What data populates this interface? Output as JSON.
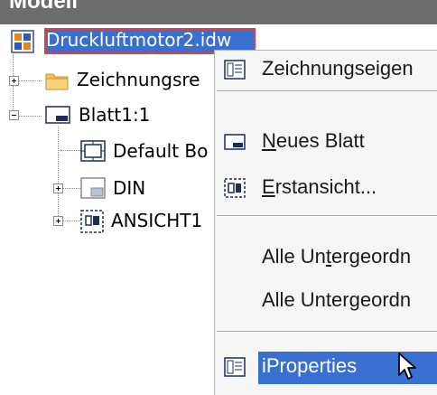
{
  "panel": {
    "title": "Modell"
  },
  "tree": {
    "root_file": "Druckluftmotor2.idw",
    "items": [
      {
        "label": "Zeichnungsre",
        "icon": "folder-icon"
      },
      {
        "label": "Blatt1:1",
        "icon": "sheet-icon"
      },
      {
        "label": "Default Bo",
        "icon": "border-icon"
      },
      {
        "label": "DIN",
        "icon": "title-block-icon"
      },
      {
        "label": "ANSICHT1",
        "icon": "base-view-icon"
      }
    ]
  },
  "context_menu": {
    "items": [
      {
        "id": "drawing-properties",
        "label": "Zeichnungseigen",
        "icon": "properties-icon"
      },
      {
        "id": "new-sheet",
        "label": "Neues Blatt",
        "icon": "sheet-icon",
        "mnemonic": "N"
      },
      {
        "id": "base-view",
        "label": "Erstansicht...",
        "icon": "base-view-icon",
        "mnemonic": "E"
      },
      {
        "id": "all-children-1",
        "label": "Alle Untergeordn",
        "mnemonic": "t"
      },
      {
        "id": "all-children-2",
        "label": "Alle Untergeordn",
        "mnemonic": "g"
      },
      {
        "id": "iproperties",
        "label": "iProperties",
        "icon": "properties-icon",
        "highlighted": true
      }
    ]
  }
}
